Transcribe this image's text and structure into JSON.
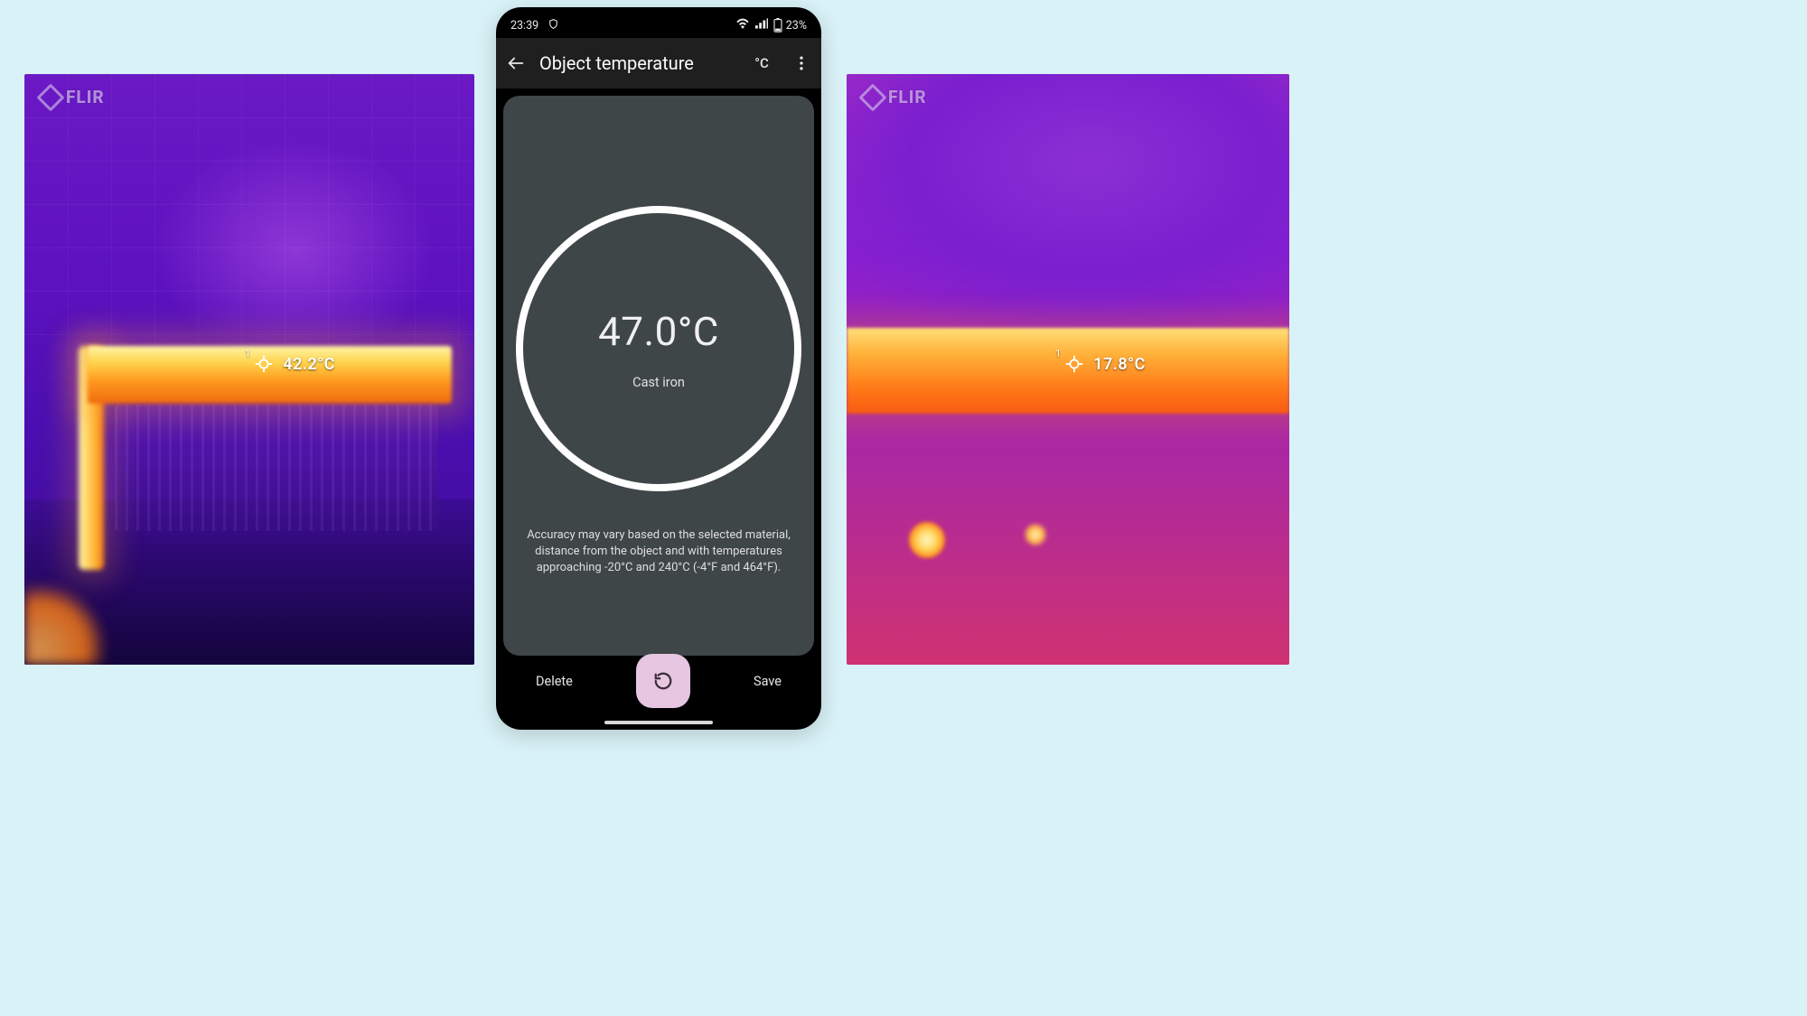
{
  "thermal_left": {
    "brand": "FLIR",
    "spot": {
      "index": "1",
      "reading": "42.2°C"
    }
  },
  "thermal_right": {
    "brand": "FLIR",
    "spot": {
      "index": "1",
      "reading": "17.8°C"
    }
  },
  "phone": {
    "status": {
      "time": "23:39",
      "battery_pct": "23%"
    },
    "appbar": {
      "title": "Object temperature",
      "unit_label": "°C"
    },
    "reading": {
      "temperature": "47.0°C",
      "material": "Cast iron"
    },
    "disclaimer": "Accuracy may vary based on the selected material, distance from the object and with temperatures approaching -20°C and 240°C (-4°F and 464°F).",
    "actions": {
      "delete": "Delete",
      "save": "Save"
    }
  }
}
